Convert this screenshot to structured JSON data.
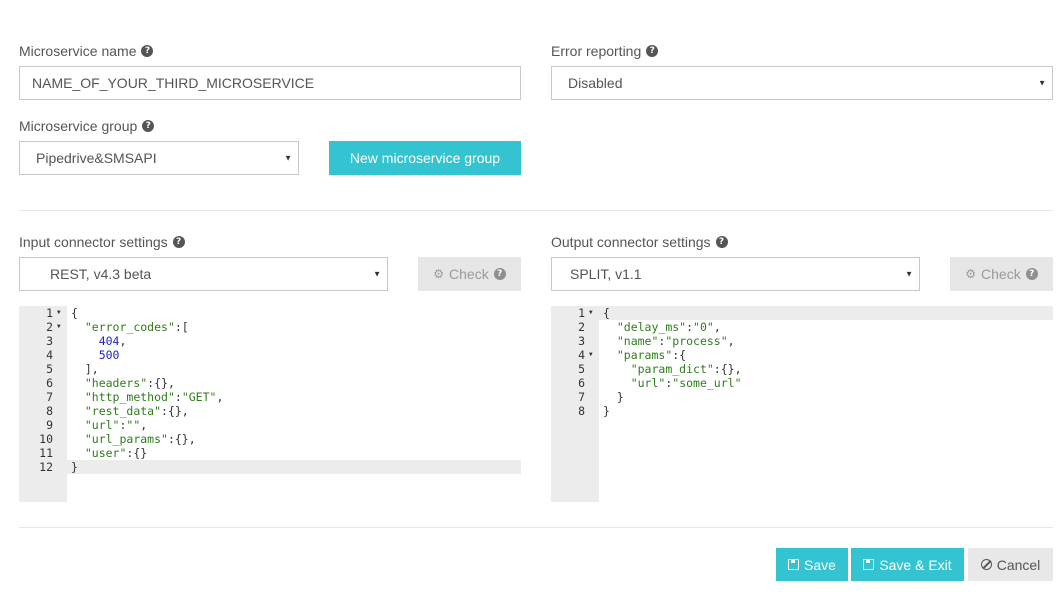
{
  "form": {
    "ms_name_label": "Microservice name",
    "ms_name_value": "NAME_OF_YOUR_THIRD_MICROSERVICE",
    "error_label": "Error reporting",
    "error_value": "Disabled",
    "group_label": "Microservice group",
    "group_value": "Pipedrive&SMSAPI",
    "new_group_button": "New microservice group"
  },
  "input": {
    "label": "Input connector settings",
    "connector": "REST, v4.3 beta",
    "check": "Check",
    "lines": [
      {
        "n": "1",
        "fold": true,
        "html": "<span class=\"p\">{</span>"
      },
      {
        "n": "2",
        "fold": true,
        "html": "  <span class=\"k\">\"error_codes\"</span><span class=\"p\">:[</span>"
      },
      {
        "n": "3",
        "fold": false,
        "html": "    <span class=\"n\">404</span><span class=\"p\">,</span>"
      },
      {
        "n": "4",
        "fold": false,
        "html": "    <span class=\"n\">500</span>"
      },
      {
        "n": "5",
        "fold": false,
        "html": "  <span class=\"p\">],</span>"
      },
      {
        "n": "6",
        "fold": false,
        "html": "  <span class=\"k\">\"headers\"</span><span class=\"p\">:{},</span>"
      },
      {
        "n": "7",
        "fold": false,
        "html": "  <span class=\"k\">\"http_method\"</span><span class=\"p\">:</span><span class=\"s\">\"GET\"</span><span class=\"p\">,</span>"
      },
      {
        "n": "8",
        "fold": false,
        "html": "  <span class=\"k\">\"rest_data\"</span><span class=\"p\">:{},</span>"
      },
      {
        "n": "9",
        "fold": false,
        "html": "  <span class=\"k\">\"url\"</span><span class=\"p\">:</span><span class=\"s\">\"\"</span><span class=\"p\">,</span>"
      },
      {
        "n": "10",
        "fold": false,
        "html": "  <span class=\"k\">\"url_params\"</span><span class=\"p\">:{},</span>"
      },
      {
        "n": "11",
        "fold": false,
        "html": "  <span class=\"k\">\"user\"</span><span class=\"p\">:{}</span>"
      },
      {
        "n": "12",
        "fold": false,
        "html": "<span class=\"p\">}</span>"
      }
    ],
    "active_line": 12
  },
  "output": {
    "label": "Output connector settings",
    "connector": "SPLIT, v1.1",
    "check": "Check",
    "lines": [
      {
        "n": "1",
        "fold": true,
        "html": "<span class=\"p\">{</span>"
      },
      {
        "n": "2",
        "fold": false,
        "html": "  <span class=\"k\">\"delay_ms\"</span><span class=\"p\">:</span><span class=\"s\">\"0\"</span><span class=\"p\">,</span>"
      },
      {
        "n": "3",
        "fold": false,
        "html": "  <span class=\"k\">\"name\"</span><span class=\"p\">:</span><span class=\"s\">\"process\"</span><span class=\"p\">,</span>"
      },
      {
        "n": "4",
        "fold": true,
        "html": "  <span class=\"k\">\"params\"</span><span class=\"p\">:{</span>"
      },
      {
        "n": "5",
        "fold": false,
        "html": "    <span class=\"k\">\"param_dict\"</span><span class=\"p\">:{},</span>"
      },
      {
        "n": "6",
        "fold": false,
        "html": "    <span class=\"k\">\"url\"</span><span class=\"p\">:</span><span class=\"s\">\"some_url\"</span>"
      },
      {
        "n": "7",
        "fold": false,
        "html": "  <span class=\"p\">}</span>"
      },
      {
        "n": "8",
        "fold": false,
        "html": "<span class=\"p\">}</span>"
      }
    ],
    "active_line": 1
  },
  "footer": {
    "save": "Save",
    "save_exit": "Save & Exit",
    "cancel": "Cancel"
  },
  "colors": {
    "accent": "#34c3d0",
    "gutter": "#ececec",
    "json_key": "#2e7d1b",
    "json_number": "#1e1ec8"
  }
}
